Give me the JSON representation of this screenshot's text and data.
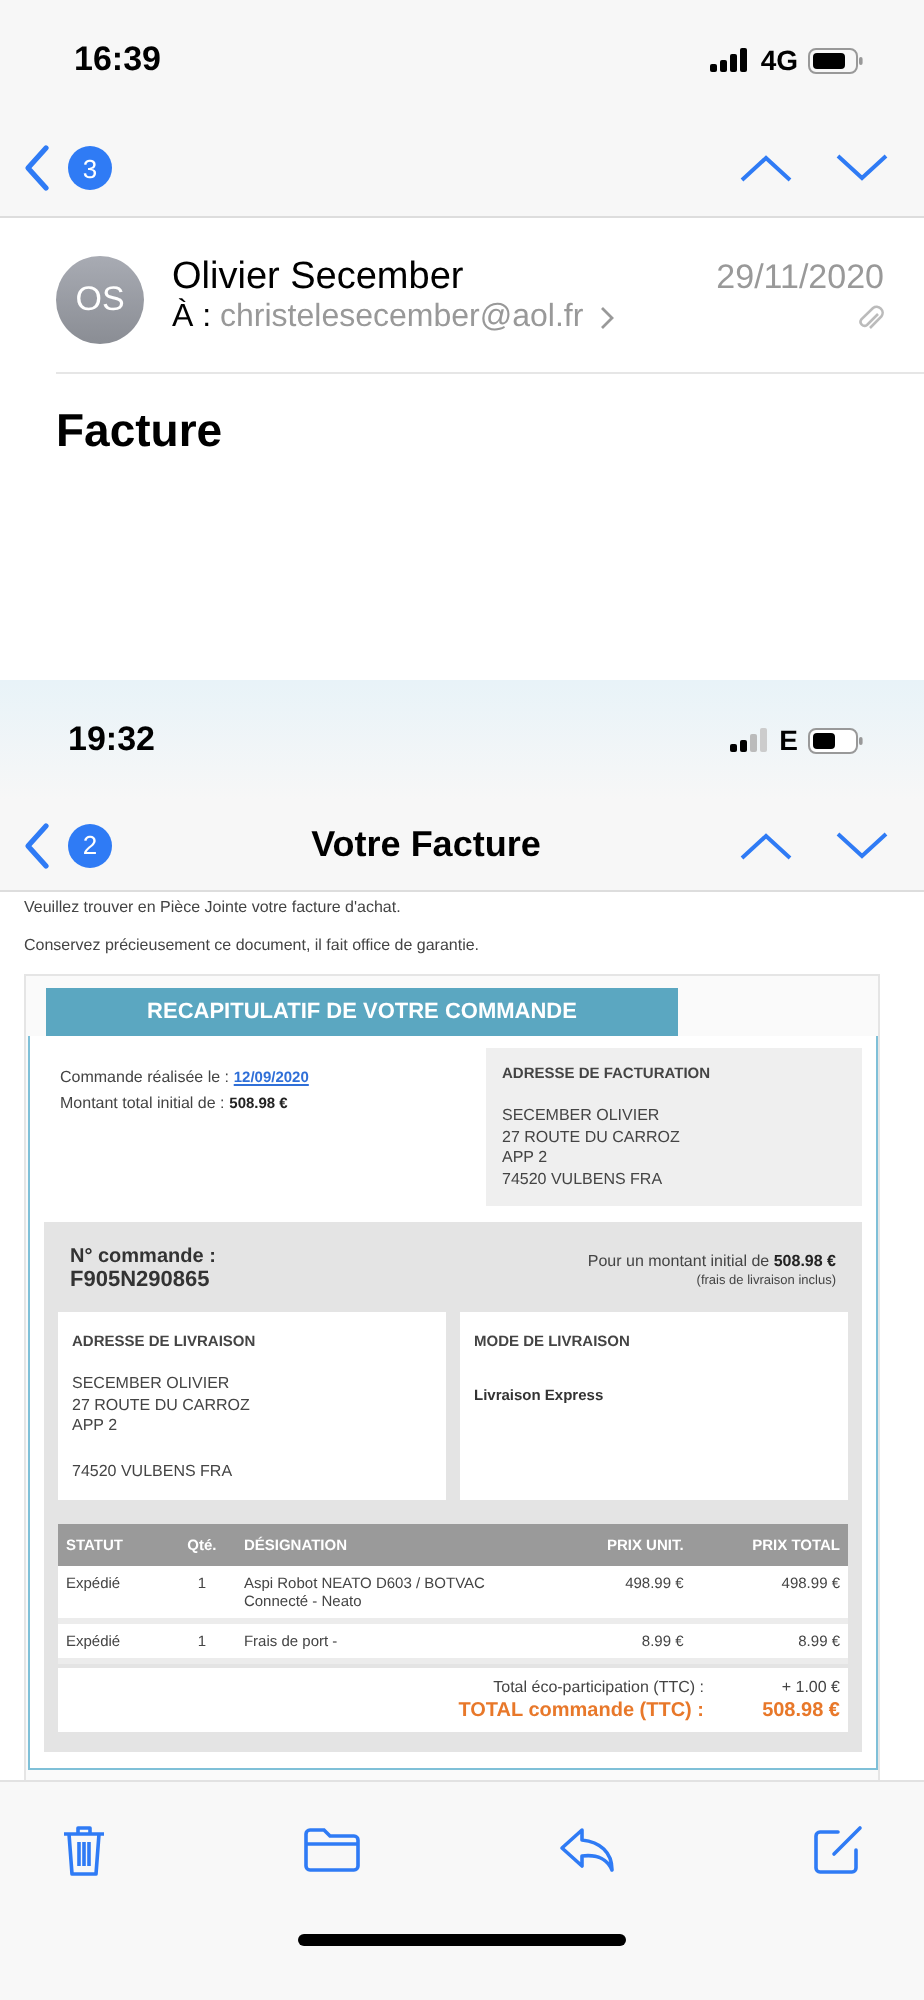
{
  "top_screen": {
    "status_bar": {
      "time": "16:39",
      "network": "4G"
    },
    "nav": {
      "badge": "3"
    },
    "sender": {
      "initials": "OS",
      "name": "Olivier Secember",
      "to_label": "À :",
      "to": "christelesecember@aol.fr",
      "date": "29/11/2020"
    },
    "subject": "Facture"
  },
  "bottom_screen": {
    "status_bar": {
      "time": "19:32",
      "network": "E"
    },
    "nav": {
      "badge": "2",
      "title": "Votre Facture"
    },
    "intro": [
      "Veuillez trouver en Pièce Jointe votre facture d'achat.",
      "Conservez précieusement ce document, il fait office de garantie."
    ],
    "summary": {
      "banner": "RECAPITULATIF DE VOTRE COMMANDE",
      "order_date_label": "Commande réalisée le :",
      "order_date": "12/09/2020",
      "total_label": "Montant total initial de :",
      "total": "508.98 €",
      "billing": {
        "heading": "ADRESSE DE FACTURATION",
        "paragraphs": [
          [
            "SECEMBER OLIVIER",
            "27 ROUTE DU CARROZ",
            "APP 2",
            "74520 VULBENS FRA"
          ]
        ]
      }
    },
    "order": {
      "number_label": "N° commande :",
      "number": "F905N290865",
      "amount_label": "Pour un montant initial de",
      "amount": "508.98 €",
      "amount_note": "(frais de livraison inclus)"
    },
    "delivery_address": {
      "heading": "ADRESSE DE LIVRAISON",
      "paragraphs": [
        [
          "SECEMBER OLIVIER",
          "27 ROUTE DU CARROZ",
          "APP 2"
        ],
        [
          "74520 VULBENS FRA"
        ]
      ]
    },
    "delivery_mode": {
      "heading": "MODE DE LIVRAISON",
      "value": "Livraison Express"
    },
    "items": {
      "columns": [
        "STATUT",
        "Qté.",
        "DÉSIGNATION",
        "PRIX UNIT.",
        "PRIX TOTAL"
      ],
      "rows": [
        [
          "Expédié",
          "1",
          "Aspi Robot NEATO D603 / BOTVAC Connecté - Neato",
          "498.99 €",
          "498.99 €"
        ],
        [
          "Expédié",
          "1",
          "Frais de port -",
          "8.99 €",
          "8.99 €"
        ]
      ]
    },
    "totals": {
      "eco_label": "Total éco-participation (TTC) :",
      "eco": "+ 1.00 €",
      "total_label": "TOTAL commande (TTC) :",
      "total": "508.98 €"
    }
  }
}
